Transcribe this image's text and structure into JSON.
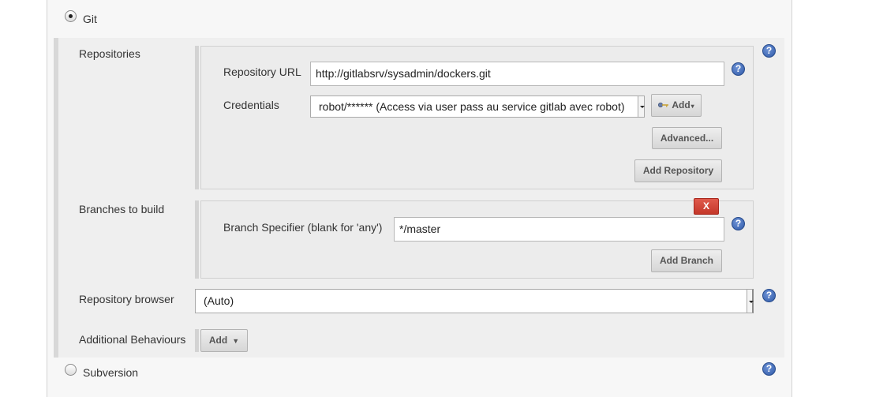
{
  "scm": {
    "git_label": "Git",
    "subversion_label": "Subversion"
  },
  "repositories": {
    "label": "Repositories",
    "url_label": "Repository URL",
    "url_value": "http://gitlabsrv/sysadmin/dockers.git",
    "credentials_label": "Credentials",
    "credentials_value": "robot/****** (Access via user pass au service gitlab avec robot)",
    "credentials_add_label": "Add",
    "advanced_label": "Advanced...",
    "add_repository_label": "Add Repository"
  },
  "branches": {
    "label": "Branches to build",
    "remove_label": "X",
    "specifier_label": "Branch Specifier (blank for 'any')",
    "specifier_value": "*/master",
    "add_branch_label": "Add Branch"
  },
  "browser": {
    "label": "Repository browser",
    "value": "(Auto)"
  },
  "behaviours": {
    "label": "Additional Behaviours",
    "add_label": "Add"
  },
  "help": {
    "glyph": "?",
    "icon": "help-icon"
  },
  "colors": {
    "help_blue": "#2f5aa8",
    "delete_red": "#c4372a",
    "panel_bg": "#efefef"
  }
}
